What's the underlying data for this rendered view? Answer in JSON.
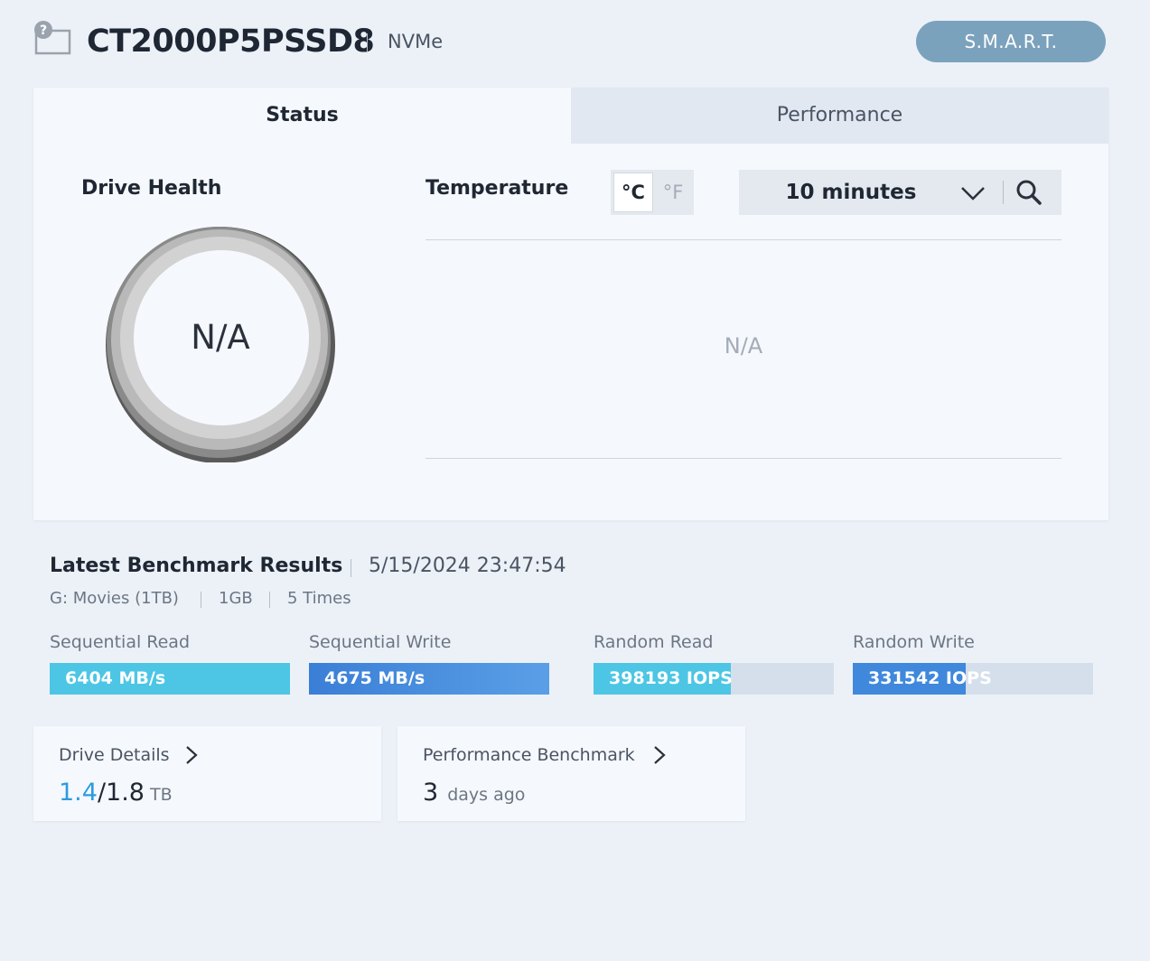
{
  "header": {
    "drive_name": "CT2000P5PSSD8",
    "interface": "NVMe",
    "smart_button": "S.M.A.R.T.",
    "icon": "unknown-drive-icon"
  },
  "tabs": [
    {
      "label": "Status",
      "active": true
    },
    {
      "label": "Performance",
      "active": false
    }
  ],
  "status": {
    "drive_health": {
      "title": "Drive Health",
      "value": "N/A"
    },
    "temperature": {
      "title": "Temperature",
      "unit_celsius": "°C",
      "unit_fahrenheit": "°F",
      "selected_unit": "°C",
      "range": "10 minutes",
      "chart_value": "N/A"
    }
  },
  "benchmark": {
    "title": "Latest Benchmark Results",
    "timestamp": "5/15/2024 23:47:54",
    "drive": "G: Movies (1TB)",
    "size": "1GB",
    "repeat": "5 Times",
    "results": [
      {
        "label": "Sequential Read",
        "value": "6404 MB/s",
        "fill_fraction": 1.0,
        "color": "#4cc6e4"
      },
      {
        "label": "Sequential Write",
        "value": "4675 MB/s",
        "fill_fraction": 1.0,
        "color": "#4f94e2"
      },
      {
        "label": "Random Read",
        "value": "398193 IOPS",
        "fill_fraction": 0.57,
        "color": "#4cc6e4"
      },
      {
        "label": "Random Write",
        "value": "331542 IOPS",
        "fill_fraction": 0.47,
        "color": "#3f88dc"
      }
    ]
  },
  "cards": {
    "drive_details": {
      "title": "Drive Details",
      "used": "1.4",
      "total": "/1.8",
      "unit": "TB"
    },
    "performance_benchmark": {
      "title": "Performance Benchmark",
      "value": "3",
      "suffix": "days ago"
    }
  },
  "colors": {
    "accent_blue": "#2d9be0",
    "smart_button": "#7ba2bd",
    "background": "#ecf1f8"
  }
}
